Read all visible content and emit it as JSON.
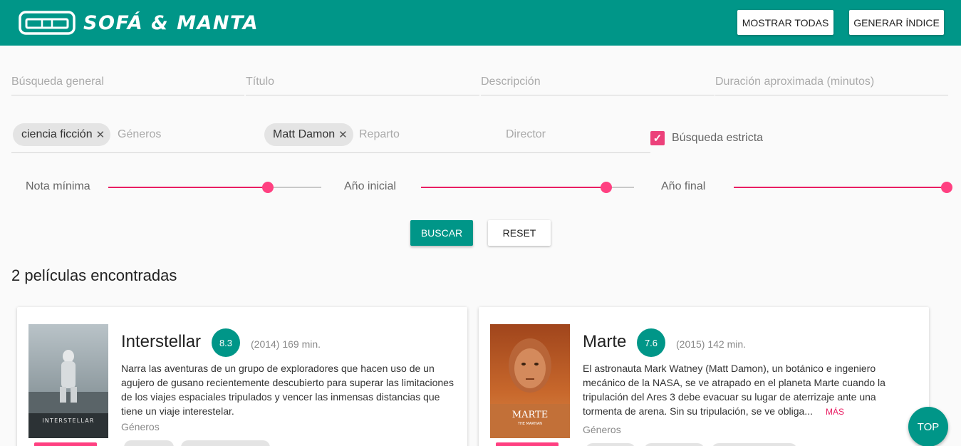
{
  "header": {
    "brand": "SOFÁ & MANTA",
    "show_all": "MOSTRAR TODAS",
    "generate_index": "GENERAR ÍNDICE",
    "bar_color": "#009688"
  },
  "filters": {
    "general": {
      "placeholder": "Búsqueda general",
      "value": ""
    },
    "title": {
      "placeholder": "Título",
      "value": ""
    },
    "description": {
      "placeholder": "Descripción",
      "value": ""
    },
    "duration": {
      "placeholder": "Duración aproximada (minutos)",
      "value": ""
    },
    "genre_chip": "ciencia ficción",
    "genres_placeholder": "Géneros",
    "cast_chip": "Matt Damon",
    "cast_placeholder": "Reparto",
    "director_placeholder": "Director",
    "strict_label": "Búsqueda estricta",
    "strict_checked": true
  },
  "sliders": {
    "min_rating": {
      "label": "Nota mínima",
      "fraction": 0.75
    },
    "year_start": {
      "label": "Año inicial",
      "fraction": 0.87
    },
    "year_end": {
      "label": "Año final",
      "fraction": 1.0
    },
    "accent_color": "#e91e63"
  },
  "actions": {
    "search": "BUSCAR",
    "reset": "RESET"
  },
  "results": {
    "count_text": "2 películas encontradas",
    "movies": [
      {
        "title": "Interstellar",
        "rating": "8.3",
        "meta": "(2014) 169 min.",
        "description": "Narra las aventuras de un grupo de exploradores que hacen uso de un agujero de gusano recientemente descubierto para superar las limitaciones de los viajes espaciales tripulados y vencer las inmensas distancias que tiene un viaje interestelar.",
        "genres_label": "Géneros",
        "poster_text": "INTERSTELLAR"
      },
      {
        "title": "Marte",
        "rating": "7.6",
        "meta": "(2015) 142 min.",
        "description": "El astronauta Mark Watney (Matt Damon), un botánico e ingeniero mecánico de la NASA, se ve atrapado en el planeta Marte cuando la tripulación del Ares 3 debe evacuar su lugar de aterrizaje ante una tormenta de arena. Sin su tripulación, se ve obliga...",
        "more": "MÁS",
        "genres_label": "Géneros",
        "poster_text": "MARTE",
        "poster_subtext": "THE MARTIAN"
      }
    ]
  },
  "fab": {
    "label": "TOP"
  }
}
